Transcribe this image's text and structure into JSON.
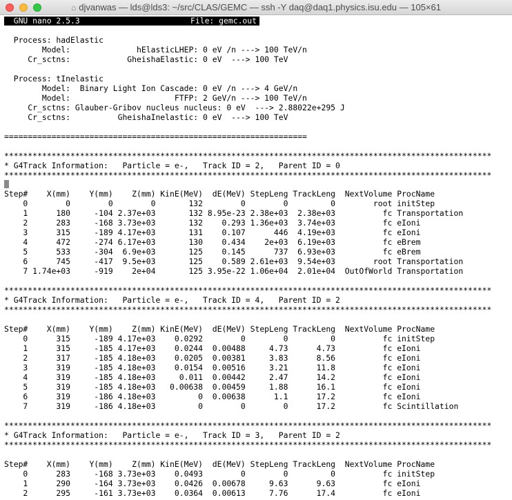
{
  "window": {
    "title": "djvanwas — lds@lds3: ~/src/CLAS/GEMC — ssh -Y daq@daq1.physics.isu.edu — 105×61",
    "icon": "home-icon"
  },
  "nano": {
    "version": "  GNU nano 2.5.3",
    "file": "File: gemc.out"
  },
  "lines": [
    "",
    "  Process: hadElastic",
    "        Model:              hElasticLHEP: 0 eV /n ---> 100 TeV/n",
    "     Cr_sctns:            GheishaElastic: 0 eV  ---> 100 TeV",
    "",
    "  Process: tInelastic",
    "        Model:  Binary Light Ion Cascade: 0 eV /n ---> 4 GeV/n",
    "        Model:                      FTFP: 2 GeV/n ---> 100 TeV/n",
    "     Cr_sctns: Glauber-Gribov nucleus nucleus: 0 eV  ---> 2.88022e+295 J",
    "     Cr_sctns:          GheishaInelastic: 0 eV  ---> 100 TeV",
    "",
    "================================================================",
    "",
    "*******************************************************************************************************",
    "* G4Track Information:   Particle = e-,   Track ID = 2,   Parent ID = 0",
    "*******************************************************************************************************",
    "",
    "Step#    X(mm)    Y(mm)    Z(mm) KinE(MeV)  dE(MeV) StepLeng TrackLeng  NextVolume ProcName",
    "    0        0        0        0       132        0        0         0        root initStep",
    "    1      180     -104 2.37e+03       132 8.95e-23 2.38e+03  2.38e+03          fc Transportation",
    "    2      283     -168 3.73e+03       132    0.293 1.36e+03  3.74e+03          fc eIoni",
    "    3      315     -189 4.17e+03       131    0.107      446  4.19e+03          fc eIoni",
    "    4      472     -274 6.17e+03       130    0.434    2e+03  6.19e+03          fc eBrem",
    "    5      533     -304  6.9e+03       125    0.145      737  6.93e+03          fc eBrem",
    "    6      745     -417  9.5e+03       125    0.589 2.61e+03  9.54e+03        root Transportation",
    "    7 1.74e+03     -919    2e+04       125 3.95e-22 1.06e+04  2.01e+04  OutOfWorld Transportation",
    "",
    "*******************************************************************************************************",
    "* G4Track Information:   Particle = e-,   Track ID = 4,   Parent ID = 2",
    "*******************************************************************************************************",
    "",
    "Step#    X(mm)    Y(mm)    Z(mm) KinE(MeV)  dE(MeV) StepLeng TrackLeng  NextVolume ProcName",
    "    0      315     -189 4.17e+03    0.0292        0        0         0          fc initStep",
    "    1      315     -185 4.17e+03    0.0244  0.00488     4.73      4.73          fc eIoni",
    "    2      317     -185 4.18e+03    0.0205  0.00381     3.83      8.56          fc eIoni",
    "    3      319     -185 4.18e+03    0.0154  0.00516     3.21      11.8          fc eIoni",
    "    4      319     -185 4.18e+03     0.011  0.00442     2.47      14.2          fc eIoni",
    "    5      319     -185 4.18e+03   0.00638  0.00459     1.88      16.1          fc eIoni",
    "    6      319     -186 4.18e+03         0  0.00638      1.1      17.2          fc eIoni",
    "    7      319     -186 4.18e+03         0        0        0      17.2          fc Scintillation",
    "",
    "*******************************************************************************************************",
    "* G4Track Information:   Particle = e-,   Track ID = 3,   Parent ID = 2",
    "*******************************************************************************************************",
    "",
    "Step#    X(mm)    Y(mm)    Z(mm) KinE(MeV)  dE(MeV) StepLeng TrackLeng  NextVolume ProcName",
    "    0      283     -168 3.73e+03    0.0493        0        0         0          fc initStep",
    "    1      290     -164 3.73e+03    0.0426  0.00678     9.63      9.63          fc eIoni",
    "    2      295     -161 3.73e+03    0.0364  0.00613     7.76      17.4          fc eIoni"
  ]
}
